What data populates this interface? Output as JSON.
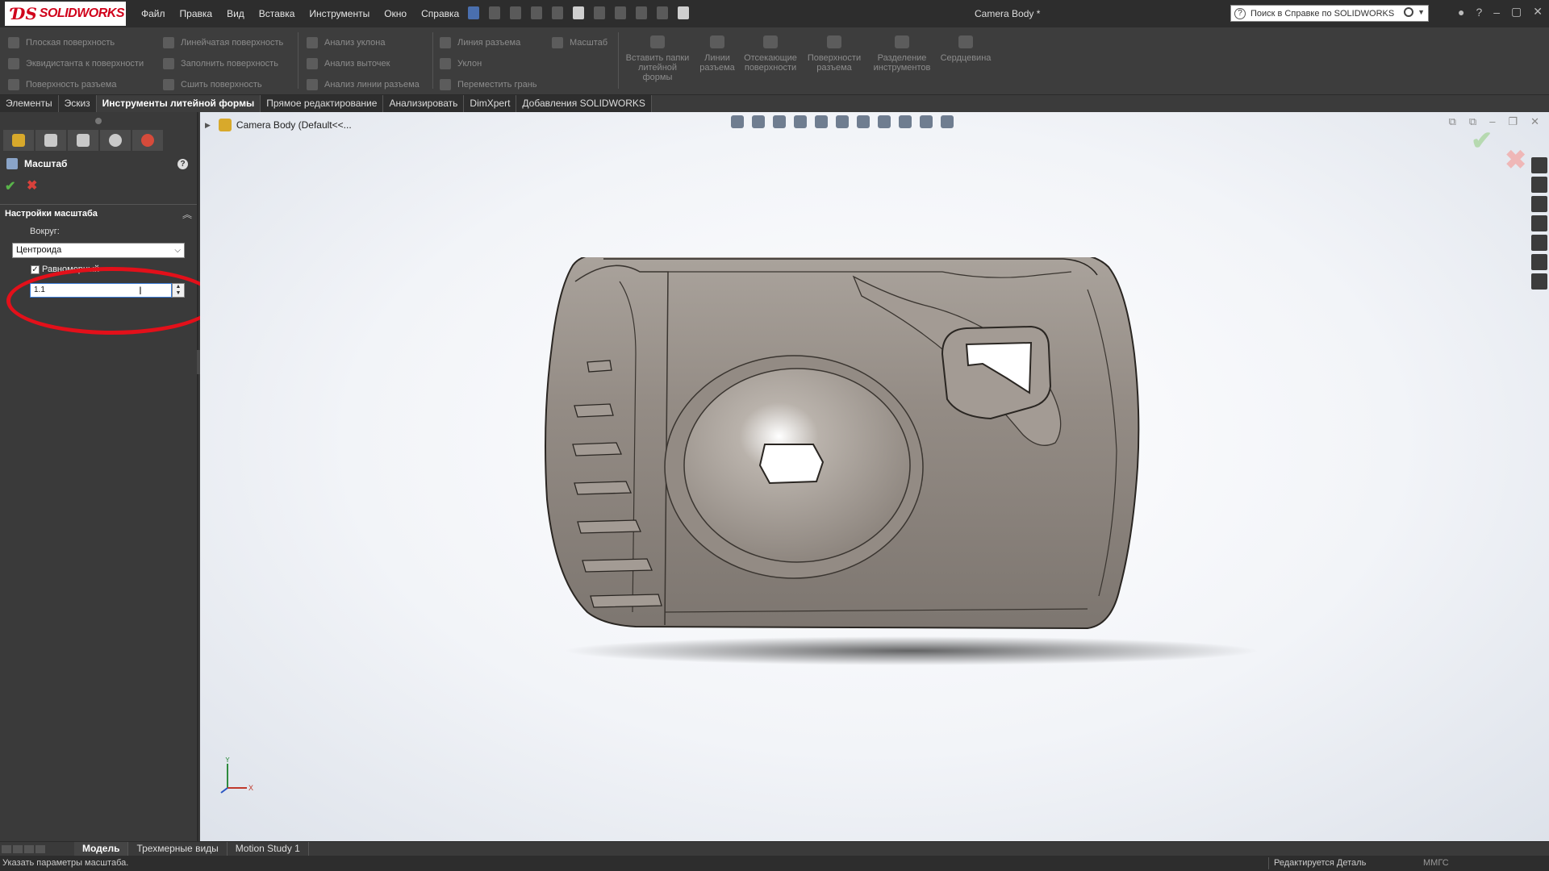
{
  "app": {
    "logo_ds": "ƊS",
    "logo_text": "SOLIDWORKS",
    "doc_title": "Camera Body *"
  },
  "menu": [
    "Файл",
    "Правка",
    "Вид",
    "Вставка",
    "Инструменты",
    "Окно",
    "Справка"
  ],
  "search": {
    "placeholder": "Поиск в Справке по SOLIDWORKS",
    "help_glyph": "?"
  },
  "window_controls": [
    "–",
    "▢",
    "✕"
  ],
  "command_manager": {
    "col1": [
      "Плоская поверхность",
      "Эквидистанта к поверхности",
      "Поверхность разъема"
    ],
    "col2": [
      "Линейчатая поверхность",
      "Заполнить поверхность",
      "Сшить поверхность"
    ],
    "col3": [
      "Анализ уклона",
      "Анализ выточек",
      "Анализ линии разъема"
    ],
    "col4": [
      "Линия разъема",
      "Уклон",
      "Переместить грань"
    ],
    "col4b": "Масштаб",
    "big": [
      "Вставить папки литейной формы",
      "Линии разъема",
      "Отсекающие поверхности",
      "Поверхности разъема",
      "Разделение инструментов",
      "Сердцевина"
    ]
  },
  "tabs": [
    "Элементы",
    "Эскиз",
    "Инструменты литейной формы",
    "Прямое редактирование",
    "Анализировать",
    "DimXpert",
    "Добавления SOLIDWORKS"
  ],
  "property_manager": {
    "title": "Масштаб",
    "help": "?",
    "ok": "✔",
    "cancel": "✖",
    "group_title": "Настройки масштаба",
    "about_label": "Вокруг:",
    "about_value": "Центроида",
    "uniform_label": "Равномерный",
    "uniform_checked": true,
    "factor_value": "1.1"
  },
  "tree": {
    "root": "Camera Body  (Default<<..."
  },
  "viewport_controls": [
    "⧉",
    "⧉",
    "–",
    "❐",
    "✕"
  ],
  "confirm": {
    "ok": "✔",
    "cancel": "✖"
  },
  "triad": {
    "x": "X",
    "y": "Y"
  },
  "bottom_tabs": [
    "Модель",
    "Трехмерные виды",
    "Motion Study 1"
  ],
  "status": {
    "message": "Указать параметры масштаба.",
    "editing": "Редактируется Деталь",
    "units": "ММГС"
  },
  "colors": {
    "accent_red": "#d0021b",
    "ok_green": "#59b44a",
    "cancel_red": "#d9413b",
    "model": "#948c85"
  }
}
